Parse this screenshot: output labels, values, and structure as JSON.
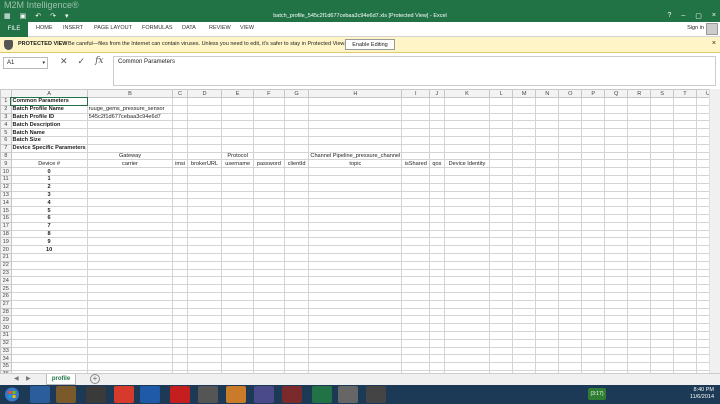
{
  "window": {
    "title": "batch_profile_545c2f1d677cebaa3c94e6d7.xls [Protected View] - Excel",
    "watermark": "M2M Intelligence®",
    "minimize": "–",
    "restore": "▢",
    "close": "×"
  },
  "ribbon": {
    "file_tab": "FILE",
    "tabs": [
      "HOME",
      "INSERT",
      "PAGE LAYOUT",
      "FORMULAS",
      "DATA",
      "REVIEW",
      "VIEW"
    ],
    "sign_in": "Sign in"
  },
  "protected_view": {
    "label": "PROTECTED VIEW",
    "message": "Be careful—files from the Internet can contain viruses. Unless you need to edit, it's safer to stay in Protected View.",
    "button": "Enable Editing",
    "close": "×"
  },
  "formula_bar": {
    "name_box": "A1",
    "content": "Common Parameters",
    "cancel": "✕",
    "enter": "✓",
    "fx": "fx"
  },
  "grid": {
    "columns": [
      "A",
      "B",
      "C",
      "D",
      "E",
      "F",
      "G",
      "H",
      "I",
      "J",
      "K",
      "L",
      "M",
      "N",
      "O",
      "P",
      "Q",
      "R",
      "S",
      "T",
      "U"
    ],
    "cells": {
      "r1": {
        "A": "Common Parameters"
      },
      "r2": {
        "A": "Batch Profile Name",
        "B": "ruuge_gems_pressure_sensor"
      },
      "r3": {
        "A": "Batch Profile ID",
        "B": "545c2f1d677cebaa3c94e6d7"
      },
      "r4": {
        "A": "Batch Description"
      },
      "r5": {
        "A": "Batch Name"
      },
      "r6": {
        "A": "Batch Size"
      },
      "r7": {
        "A": "Device Specific Parameters"
      },
      "r8": {
        "A": "",
        "B": "Gateway",
        "E": "Protocol",
        "H": "Channel Pipeline_pressure_channel"
      },
      "r9": {
        "A": "Device #",
        "B": "carrier",
        "C": "imsi",
        "D": "brokerURL",
        "E": "username",
        "F": "password",
        "G": "clientId",
        "H": "topic",
        "I": "isShared",
        "J": "qos",
        "K": "Device Identity"
      },
      "devices": [
        "0",
        "1",
        "2",
        "3",
        "4",
        "5",
        "6",
        "7",
        "8",
        "9",
        "10"
      ]
    }
  },
  "sheet_tabs": {
    "active": "profile",
    "add": "+",
    "prev": "◀",
    "next": "▶"
  },
  "taskbar": {
    "time": "8:40 PM",
    "date": "11/6/2014",
    "tray_badge": "(3:17)"
  },
  "colors": {
    "excel_green": "#217346",
    "warning_bar": "#fff5c6",
    "taskbar": "#1c3a55"
  }
}
